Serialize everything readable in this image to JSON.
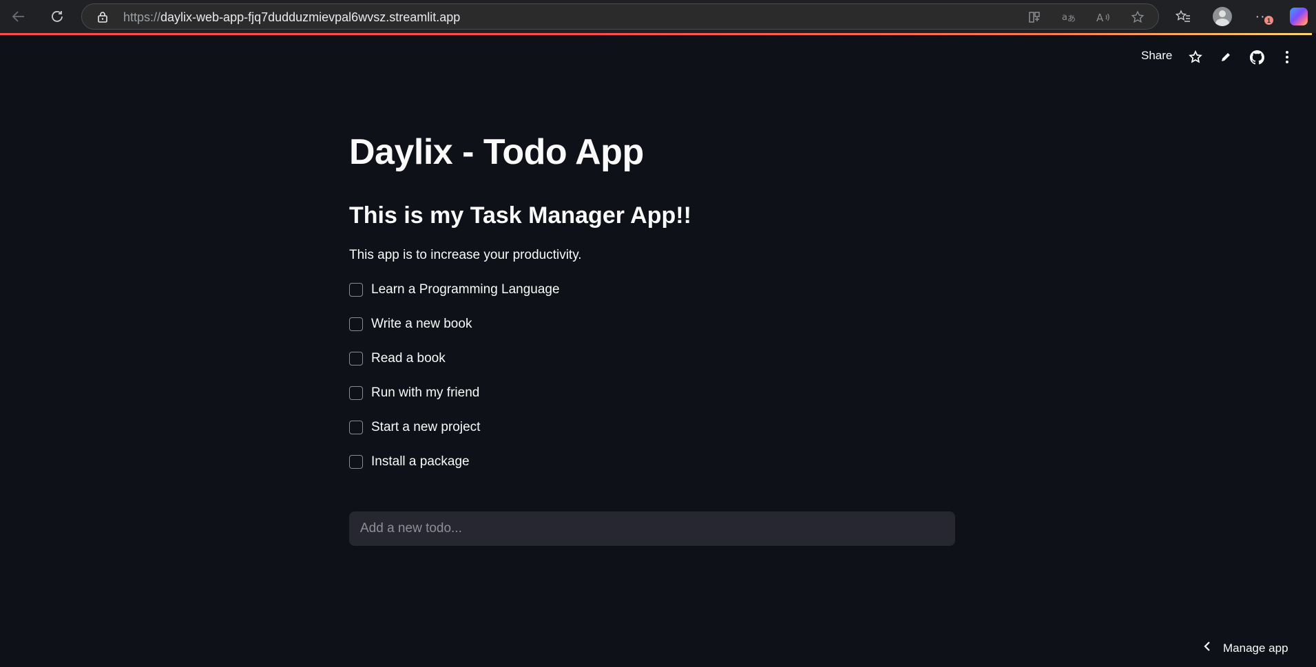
{
  "browser": {
    "url_protocol": "https://",
    "url_host": "daylix-web-app-fjq7dudduzmievpal6wvsz.streamlit.app",
    "notification_count": "1",
    "icons": {
      "back": "back-arrow-icon",
      "reload": "reload-icon",
      "lock": "lock-icon",
      "app_available": "app-available-icon",
      "translate": "translate-icon",
      "read_aloud": "read-aloud-icon",
      "favorite": "favorite-star-icon",
      "favorites_list": "favorites-list-icon",
      "profile": "profile-icon",
      "more": "more-icon",
      "copilot": "copilot-icon"
    }
  },
  "toolbar": {
    "share_label": "Share",
    "icons": [
      "star-icon",
      "edit-pencil-icon",
      "github-icon",
      "more-vertical-icon"
    ]
  },
  "page": {
    "title": "Daylix - Todo App",
    "subtitle": "This is my Task Manager App!!",
    "description": "This app is to increase your productivity."
  },
  "todos": [
    {
      "label": "Learn a Programming Language",
      "checked": false
    },
    {
      "label": "Write a new book",
      "checked": false
    },
    {
      "label": "Read a book",
      "checked": false
    },
    {
      "label": "Run with my friend",
      "checked": false
    },
    {
      "label": "Start a new project",
      "checked": false
    },
    {
      "label": "Install a package",
      "checked": false
    }
  ],
  "new_todo": {
    "placeholder": "Add a new todo...",
    "value": ""
  },
  "footer": {
    "manage_app_label": "Manage app"
  },
  "colors": {
    "background": "#0e1117",
    "text": "#fafafa",
    "input_bg": "#262730",
    "accent": "#ff4b4b"
  }
}
